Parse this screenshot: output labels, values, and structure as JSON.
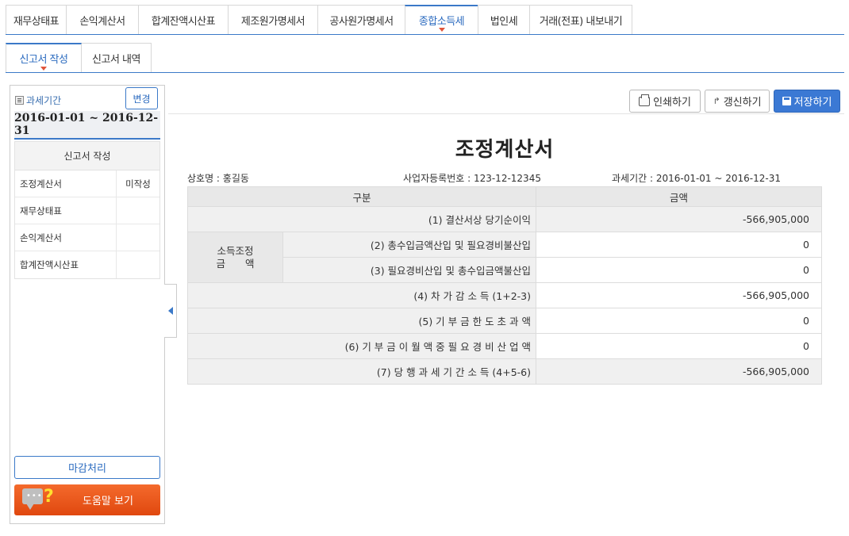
{
  "top_tabs": [
    {
      "label": "재무상태표",
      "active": false
    },
    {
      "label": "손익계산서",
      "active": false
    },
    {
      "label": "합계잔액시산표",
      "active": false
    },
    {
      "label": "제조원가명세서",
      "active": false
    },
    {
      "label": "공사원가명세서",
      "active": false
    },
    {
      "label": "종합소득세",
      "active": true
    },
    {
      "label": "법인세",
      "active": false
    },
    {
      "label": "거래(전표) 내보내기",
      "active": false
    }
  ],
  "sub_tabs": [
    {
      "label": "신고서 작성",
      "active": true
    },
    {
      "label": "신고서 내역",
      "active": false
    }
  ],
  "sidebar": {
    "period_label": "과세기간",
    "change_button": "변경",
    "period_value": "2016-01-01 ~ 2016-12-31",
    "list_header": "신고서 작성",
    "items": [
      {
        "name": "조정계산서",
        "status": "미작성"
      },
      {
        "name": "재무상태표",
        "status": ""
      },
      {
        "name": "손익계산서",
        "status": ""
      },
      {
        "name": "합계잔액시산표",
        "status": ""
      }
    ],
    "close_button": "마감처리",
    "help_button": "도움말 보기"
  },
  "toolbar": {
    "print": "인쇄하기",
    "refresh": "갱신하기",
    "save": "저장하기"
  },
  "document": {
    "title": "조정계산서",
    "company": "상호명 : 홍길동",
    "biz_no": "사업자등록번호 : 123-12-12345",
    "period": "과세기간 : 2016-01-01 ~ 2016-12-31",
    "col_category": "구분",
    "col_amount": "금액",
    "group_label_1": "소득조정",
    "group_label_2": "금　　액",
    "rows": [
      {
        "label": "(1) 결산서상 당기순이익",
        "amount": "-566,905,000"
      },
      {
        "label": "(2) 총수입금액산입 및 필요경비불산입",
        "amount": "0"
      },
      {
        "label": "(3) 필요경비산입 및 총수입금액불산입",
        "amount": "0"
      },
      {
        "label": "(4) 차 가 감 소 득 (1+2-3)",
        "amount": "-566,905,000"
      },
      {
        "label": "(5) 기 부 금 한 도 초 과 액",
        "amount": "0"
      },
      {
        "label": "(6) 기 부 금 이 월 액 중 필 요 경 비 산 업 액",
        "amount": "0"
      },
      {
        "label": "(7) 당 행 과 세 기 간 소 득 (4+5-6)",
        "amount": "-566,905,000"
      }
    ]
  }
}
